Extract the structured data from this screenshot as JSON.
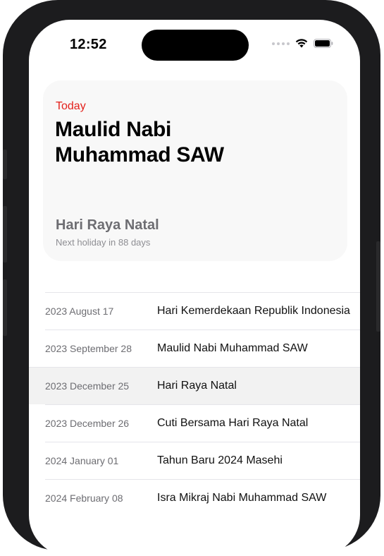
{
  "status_bar": {
    "time": "12:52"
  },
  "today_card": {
    "today_label": "Today",
    "current_holiday": "Maulid Nabi Muhammad SAW",
    "next_holiday_name": "Hari Raya Natal",
    "next_holiday_info": "Next holiday in 88 days"
  },
  "holiday_list": [
    {
      "date": "2023 August 17",
      "name": "Hari Kemerdekaan Republik Indonesia"
    },
    {
      "date": "2023 September 28",
      "name": "Maulid Nabi Muhammad SAW"
    },
    {
      "date": "2023 December 25",
      "name": "Hari Raya Natal"
    },
    {
      "date": "2023 December 26",
      "name": "Cuti Bersama Hari Raya Natal"
    },
    {
      "date": "2024 January 01",
      "name": "Tahun Baru 2024 Masehi"
    },
    {
      "date": "2024 February 08",
      "name": "Isra Mikraj Nabi Muhammad SAW"
    }
  ],
  "colors": {
    "accent_red": "#e3201b",
    "highlight_row": "#f2f2f2"
  },
  "icons": [
    "cellular-dots-icon",
    "wifi-icon",
    "battery-icon"
  ]
}
